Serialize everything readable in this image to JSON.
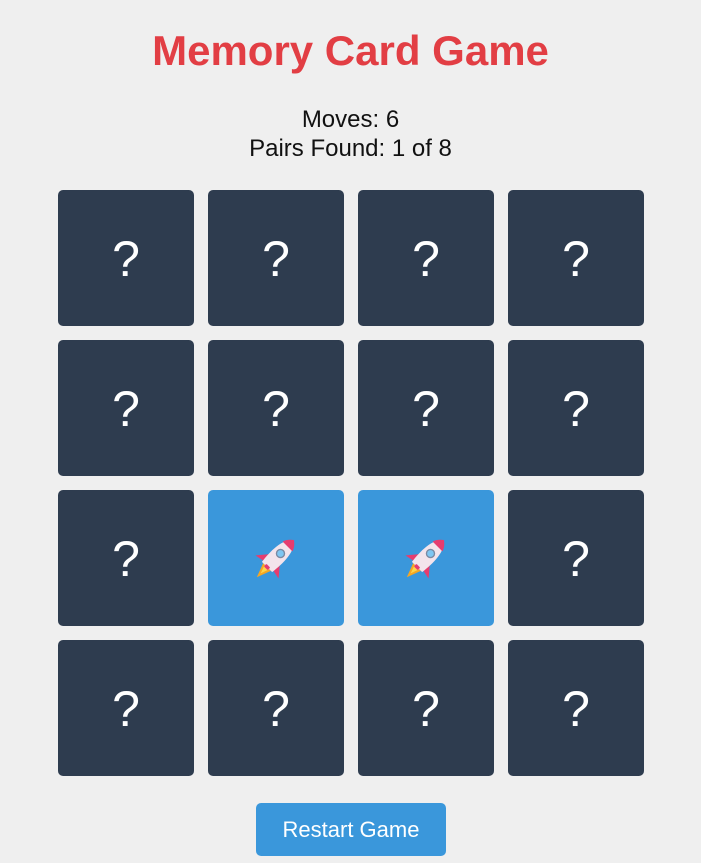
{
  "title": "Memory Card Game",
  "stats": {
    "moves_text": "Moves: 6",
    "pairs_text": "Pairs Found: 1 of 8"
  },
  "cards": [
    {
      "state": "hidden",
      "face": "?"
    },
    {
      "state": "hidden",
      "face": "?"
    },
    {
      "state": "hidden",
      "face": "?"
    },
    {
      "state": "hidden",
      "face": "?"
    },
    {
      "state": "hidden",
      "face": "?"
    },
    {
      "state": "hidden",
      "face": "?"
    },
    {
      "state": "hidden",
      "face": "?"
    },
    {
      "state": "hidden",
      "face": "?"
    },
    {
      "state": "hidden",
      "face": "?"
    },
    {
      "state": "revealed",
      "icon": "rocket-icon"
    },
    {
      "state": "revealed",
      "icon": "rocket-icon"
    },
    {
      "state": "hidden",
      "face": "?"
    },
    {
      "state": "hidden",
      "face": "?"
    },
    {
      "state": "hidden",
      "face": "?"
    },
    {
      "state": "hidden",
      "face": "?"
    },
    {
      "state": "hidden",
      "face": "?"
    }
  ],
  "restart_label": "Restart Game",
  "colors": {
    "title": "#e23e44",
    "card_back": "#2e3c4f",
    "card_revealed": "#3a97db",
    "button": "#3a97db",
    "background": "#efefef"
  }
}
